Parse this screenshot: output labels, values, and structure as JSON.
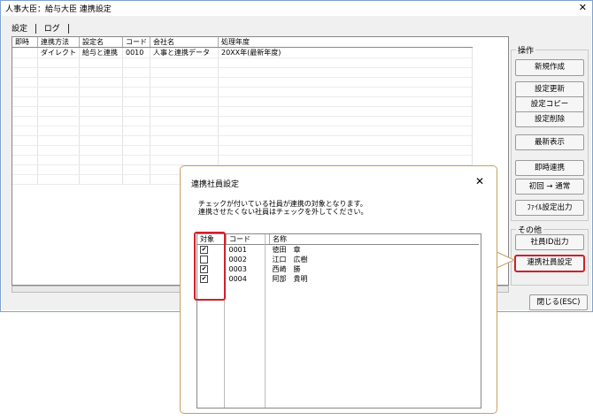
{
  "window": {
    "title": "人事大臣：給与大臣 連携設定",
    "close_glyph": "✕"
  },
  "tabs": [
    {
      "label": "設定"
    },
    {
      "label": "ログ"
    }
  ],
  "main_table": {
    "headers": [
      "即時",
      "連携方法",
      "設定名",
      "コード",
      "会社名",
      "処理年度"
    ],
    "rows": [
      [
        "",
        "ダイレクト",
        "給与と連携",
        "0010",
        "人事と連携データ",
        "20XX年(最新年度)"
      ]
    ]
  },
  "operations": {
    "group_label": "操作",
    "buttons": {
      "new": "新規作成",
      "update": "設定更新",
      "copy": "設定コピー",
      "delete": "設定削除",
      "refresh": "最新表示",
      "immediate": "即時連携",
      "first_normal": "初回 → 通常",
      "file_output": "ﾌｧｲﾙ設定出力"
    }
  },
  "other": {
    "group_label": "その他",
    "buttons": {
      "employee_id_output": "社員ID出力",
      "linked_employees": "連携社員設定"
    }
  },
  "close_button": "閉じる(ESC)",
  "dialog": {
    "title": "連携社員設定",
    "close_glyph": "✕",
    "message_line1": "チェックが付いている社員が連携の対象となります。",
    "message_line2": "連携させたくない社員はチェックを外してください。",
    "headers": {
      "target": "対象",
      "code": "コード",
      "name": "名称"
    },
    "rows": [
      {
        "checked": true,
        "check_glyph": "✔",
        "code": "0001",
        "name": "徳田　章"
      },
      {
        "checked": false,
        "check_glyph": "",
        "code": "0002",
        "name": "江口　広樹"
      },
      {
        "checked": true,
        "check_glyph": "✔",
        "code": "0003",
        "name": "西崎　勝"
      },
      {
        "checked": true,
        "check_glyph": "✔",
        "code": "0004",
        "name": "阿部　貴明"
      }
    ]
  },
  "colors": {
    "highlight": "#d0202a",
    "callout_border": "#c8a060",
    "window_border": "#7da2ce"
  }
}
